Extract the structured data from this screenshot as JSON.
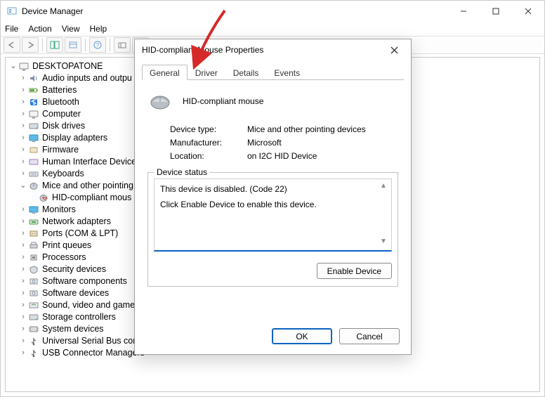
{
  "window": {
    "title": "Device Manager",
    "menus": {
      "file": "File",
      "action": "Action",
      "view": "View",
      "help": "Help"
    },
    "root_node": "DESKTOPATONE"
  },
  "tree_nodes": [
    {
      "label": "Audio inputs and outpu",
      "expanded": false
    },
    {
      "label": "Batteries",
      "expanded": false
    },
    {
      "label": "Bluetooth",
      "expanded": false
    },
    {
      "label": "Computer",
      "expanded": false
    },
    {
      "label": "Disk drives",
      "expanded": false
    },
    {
      "label": "Display adapters",
      "expanded": false
    },
    {
      "label": "Firmware",
      "expanded": false
    },
    {
      "label": "Human Interface Device",
      "expanded": false
    },
    {
      "label": "Keyboards",
      "expanded": false
    },
    {
      "label": "Mice and other pointing",
      "expanded": true,
      "children": [
        {
          "label": "HID-compliant mous"
        }
      ]
    },
    {
      "label": "Monitors",
      "expanded": false
    },
    {
      "label": "Network adapters",
      "expanded": false
    },
    {
      "label": "Ports (COM & LPT)",
      "expanded": false
    },
    {
      "label": "Print queues",
      "expanded": false
    },
    {
      "label": "Processors",
      "expanded": false
    },
    {
      "label": "Security devices",
      "expanded": false
    },
    {
      "label": "Software components",
      "expanded": false
    },
    {
      "label": "Software devices",
      "expanded": false
    },
    {
      "label": "Sound, video and game",
      "expanded": false
    },
    {
      "label": "Storage controllers",
      "expanded": false
    },
    {
      "label": "System devices",
      "expanded": false
    },
    {
      "label": "Universal Serial Bus cont",
      "expanded": false
    },
    {
      "label": "USB Connector Managers",
      "expanded": false
    }
  ],
  "dialog": {
    "title": "HID-compliant Mouse Properties",
    "tabs": {
      "general": "General",
      "driver": "Driver",
      "details": "Details",
      "events": "Events"
    },
    "device_name": "HID-compliant mouse",
    "props": {
      "device_type_label": "Device type:",
      "device_type_value": "Mice and other pointing devices",
      "manufacturer_label": "Manufacturer:",
      "manufacturer_value": "Microsoft",
      "location_label": "Location:",
      "location_value": "on I2C HID Device"
    },
    "status": {
      "legend": "Device status",
      "line1": "This device is disabled. (Code 22)",
      "line2": "Click Enable Device to enable this device."
    },
    "buttons": {
      "enable": "Enable Device",
      "ok": "OK",
      "cancel": "Cancel"
    }
  }
}
